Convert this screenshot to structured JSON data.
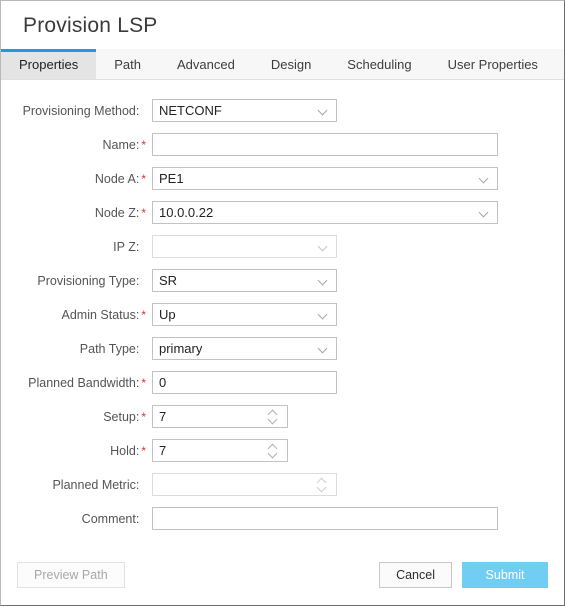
{
  "window": {
    "title": "Provision LSP"
  },
  "tabs": [
    {
      "label": "Properties",
      "active": true
    },
    {
      "label": "Path",
      "active": false
    },
    {
      "label": "Advanced",
      "active": false
    },
    {
      "label": "Design",
      "active": false
    },
    {
      "label": "Scheduling",
      "active": false
    },
    {
      "label": "User Properties",
      "active": false
    }
  ],
  "form": {
    "fields": [
      {
        "name": "provisioning-method",
        "label": "Provisioning Method:",
        "required": false,
        "type": "select",
        "value": "NETCONF",
        "width": "narrow",
        "disabled": false
      },
      {
        "name": "name",
        "label": "Name:",
        "required": true,
        "type": "text",
        "value": "",
        "width": "wide",
        "disabled": false
      },
      {
        "name": "node-a",
        "label": "Node A:",
        "required": true,
        "type": "select",
        "value": "PE1",
        "width": "wide",
        "disabled": false
      },
      {
        "name": "node-z",
        "label": "Node Z:",
        "required": true,
        "type": "select",
        "value": "10.0.0.22",
        "width": "wide",
        "disabled": false
      },
      {
        "name": "ip-z",
        "label": "IP Z:",
        "required": false,
        "type": "select",
        "value": "",
        "width": "narrow",
        "disabled": true
      },
      {
        "name": "provisioning-type",
        "label": "Provisioning Type:",
        "required": false,
        "type": "select",
        "value": "SR",
        "width": "narrow",
        "disabled": false
      },
      {
        "name": "admin-status",
        "label": "Admin Status:",
        "required": true,
        "type": "select",
        "value": "Up",
        "width": "narrow",
        "disabled": false
      },
      {
        "name": "path-type",
        "label": "Path Type:",
        "required": false,
        "type": "select",
        "value": "primary",
        "width": "narrow",
        "disabled": false
      },
      {
        "name": "planned-bandwidth",
        "label": "Planned Bandwidth:",
        "required": true,
        "type": "text",
        "value": "0",
        "width": "narrow",
        "disabled": false
      },
      {
        "name": "setup",
        "label": "Setup:",
        "required": true,
        "type": "spinner",
        "value": "7",
        "width": "spin",
        "disabled": false
      },
      {
        "name": "hold",
        "label": "Hold:",
        "required": true,
        "type": "spinner",
        "value": "7",
        "width": "spin",
        "disabled": false
      },
      {
        "name": "planned-metric",
        "label": "Planned Metric:",
        "required": false,
        "type": "spinner",
        "value": "",
        "width": "narrow",
        "disabled": true
      },
      {
        "name": "comment",
        "label": "Comment:",
        "required": false,
        "type": "text",
        "value": "",
        "width": "wide",
        "disabled": false
      }
    ]
  },
  "footer": {
    "preview_path_label": "Preview Path",
    "cancel_label": "Cancel",
    "submit_label": "Submit"
  },
  "colors": {
    "accent": "#1e9be0",
    "submit": "#72cdf4",
    "required_asterisk": "#e8312a"
  }
}
